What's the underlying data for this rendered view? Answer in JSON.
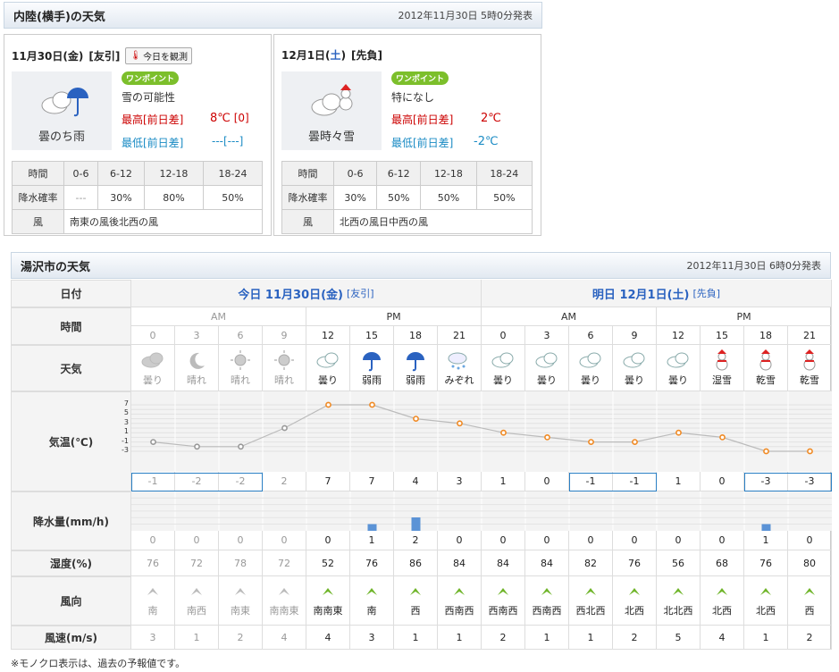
{
  "region": {
    "title": "内陸(横手)の天気",
    "issued": "2012年11月30日 5時0分発表",
    "observe_btn": "今日を観測",
    "days": [
      {
        "date": "11月30日(金)",
        "rokuyo": "[友引]",
        "icon": "cloud-then-rain-icon",
        "weather": "曇のち雨",
        "onepoint_badge": "ワンポイント",
        "onepoint": "雪の可能性",
        "hi_label": "最高[前日差]",
        "hi_val": "8℃",
        "hi_diff": "[0]",
        "lo_label": "最低[前日差]",
        "lo_val": "---[---]",
        "table_h": [
          "時間",
          "0-6",
          "6-12",
          "12-18",
          "18-24"
        ],
        "table_p": [
          "降水確率",
          "---",
          "30%",
          "80%",
          "50%"
        ],
        "wind_label": "風",
        "wind": "南東の風後北西の風"
      },
      {
        "date": "12月1日(",
        "dow": "土",
        "date_end": ")",
        "rokuyo": "[先負]",
        "icon": "cloud-sometimes-snow-icon",
        "weather": "曇時々雪",
        "onepoint_badge": "ワンポイント",
        "onepoint": "特になし",
        "hi_label": "最高[前日差]",
        "hi_val": "2℃",
        "hi_diff": "",
        "lo_label": "最低[前日差]",
        "lo_val": "-2℃",
        "table_h": [
          "時間",
          "0-6",
          "6-12",
          "12-18",
          "18-24"
        ],
        "table_p": [
          "降水確率",
          "30%",
          "50%",
          "50%",
          "50%"
        ],
        "wind_label": "風",
        "wind": "北西の風日中西の風"
      }
    ]
  },
  "city": {
    "title": "湯沢市の天気",
    "issued": "2012年11月30日 6時0分発表",
    "row_labels": {
      "date": "日付",
      "time": "時間",
      "weather": "天気",
      "temp": "気温(℃)",
      "precip": "降水量(mm/h)",
      "humidity": "湿度(%)",
      "wind_dir": "風向",
      "wind_speed": "風速(m/s)"
    },
    "today": {
      "label": "今日 11月30日(金)",
      "rokuyo": "[友引]"
    },
    "tomorrow": {
      "label": "明日 12月1日(土)",
      "rokuyo": "[先負]"
    },
    "ampm": [
      "AM",
      "PM",
      "AM",
      "PM"
    ],
    "temp_ticks": [
      "7",
      "5",
      "3",
      "1",
      "-1",
      "-3"
    ],
    "hours": [
      "0",
      "3",
      "6",
      "9",
      "12",
      "15",
      "18",
      "21",
      "0",
      "3",
      "6",
      "9",
      "12",
      "15",
      "18",
      "21"
    ],
    "past": [
      true,
      true,
      true,
      true,
      false,
      false,
      false,
      false,
      false,
      false,
      false,
      false,
      false,
      false,
      false,
      false
    ],
    "weather": [
      "曇り",
      "晴れ",
      "晴れ",
      "晴れ",
      "曇り",
      "弱雨",
      "弱雨",
      "みぞれ",
      "曇り",
      "曇り",
      "曇り",
      "曇り",
      "曇り",
      "湿雪",
      "乾雪",
      "乾雪"
    ],
    "weather_icons": [
      "cloud-icon",
      "moon-icon",
      "sun-icon",
      "sun-icon",
      "cloud-icon",
      "umbrella-icon",
      "umbrella-icon",
      "sleet-icon",
      "cloud-icon",
      "cloud-icon",
      "cloud-icon",
      "cloud-icon",
      "cloud-icon",
      "snowman-icon",
      "snowman-icon",
      "snowman-icon"
    ],
    "temps": [
      -1,
      -2,
      -2,
      2,
      7,
      7,
      4,
      3,
      1,
      0,
      -1,
      -1,
      1,
      0,
      -3,
      -3
    ],
    "boxed_temps": [
      0,
      1,
      2,
      10,
      11,
      14,
      15
    ],
    "precip": [
      0,
      0,
      0,
      0,
      0,
      1,
      2,
      0,
      0,
      0,
      0,
      0,
      0,
      0,
      1,
      0
    ],
    "humidity": [
      76,
      72,
      78,
      72,
      52,
      76,
      86,
      84,
      84,
      84,
      82,
      76,
      56,
      68,
      76,
      80
    ],
    "wind_dir": [
      "南",
      "南西",
      "南東",
      "南南東",
      "南南東",
      "南",
      "西",
      "西南西",
      "西南西",
      "西南西",
      "西北西",
      "北西",
      "北北西",
      "北西",
      "北西",
      "西"
    ],
    "wind_speed": [
      3,
      1,
      2,
      4,
      4,
      3,
      1,
      1,
      2,
      1,
      1,
      2,
      5,
      4,
      1,
      2
    ],
    "colors": {
      "past": "#999999",
      "line_past": "#aaaaaa",
      "line": "#bbbbbb",
      "point": "#f08a24",
      "bar": "#5b93d6",
      "arrow": "#6fb52a"
    }
  },
  "note": "※モノクロ表示は、過去の予報値です。"
}
